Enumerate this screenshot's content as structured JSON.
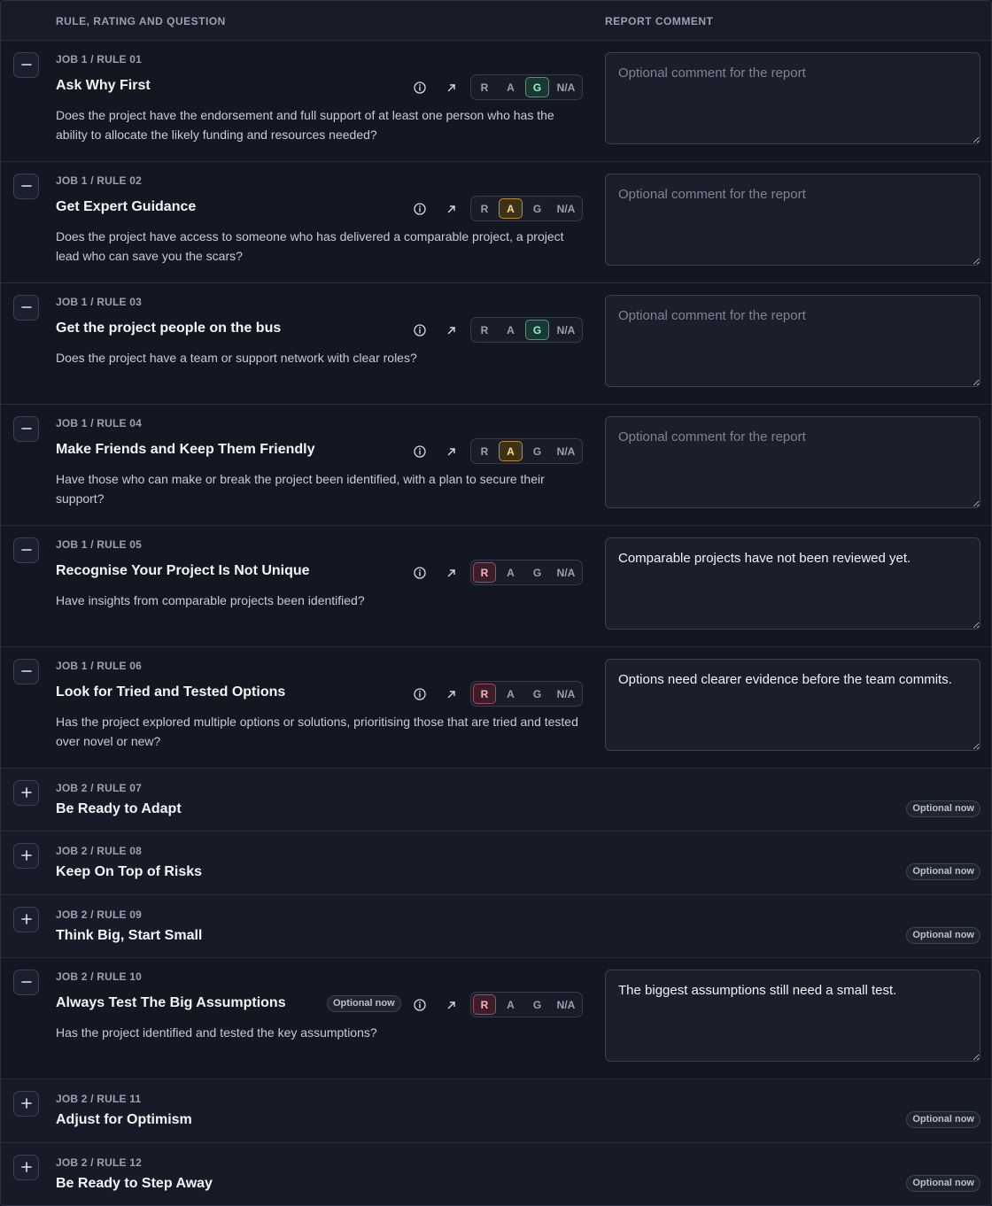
{
  "header": {
    "left": "RULE, RATING AND QUESTION",
    "right": "REPORT COMMENT"
  },
  "rating_options": [
    "R",
    "A",
    "G",
    "N/A"
  ],
  "comment_placeholder": "Optional comment for the report",
  "optional_badge": "Optional now",
  "rules": [
    {
      "meta": "JOB 1 / RULE 01",
      "title": "Ask Why First",
      "question": "Does the project have the endorsement and full support of at least one person who has the ability to allocate the likely funding and resources needed?",
      "rating": "G",
      "comment": ""
    },
    {
      "meta": "JOB 1 / RULE 02",
      "title": "Get Expert Guidance",
      "question": "Does the project have access to someone who has delivered a comparable project, a project lead who can save you the scars?",
      "rating": "A",
      "comment": ""
    },
    {
      "meta": "JOB 1 / RULE 03",
      "title": "Get the project people on the bus",
      "question": "Does the project have a team or support network with clear roles?",
      "rating": "G",
      "comment": ""
    },
    {
      "meta": "JOB 1 / RULE 04",
      "title": "Make Friends and Keep Them Friendly",
      "question": "Have those who can make or break the project been identified, with a plan to secure their support?",
      "rating": "A",
      "comment": ""
    },
    {
      "meta": "JOB 1 / RULE 05",
      "title": "Recognise Your Project Is Not Unique",
      "question": "Have insights from comparable projects been identified?",
      "rating": "R",
      "comment": "Comparable projects have not been reviewed yet."
    },
    {
      "meta": "JOB 1 / RULE 06",
      "title": "Look for Tried and Tested Options",
      "question": "Has the project explored multiple options or solutions, prioritising those that are tried and tested over novel or new?",
      "rating": "R",
      "comment": "Options need clearer evidence before the team commits."
    },
    {
      "meta": "JOB 2 / RULE 07",
      "title": "Be Ready to Adapt",
      "collapsed": true,
      "optional": true
    },
    {
      "meta": "JOB 2 / RULE 08",
      "title": "Keep On Top of Risks",
      "collapsed": true,
      "optional": true
    },
    {
      "meta": "JOB 2 / RULE 09",
      "title": "Think Big, Start Small",
      "collapsed": true,
      "optional": true
    },
    {
      "meta": "JOB 2 / RULE 10",
      "title": "Always Test The Big Assumptions",
      "question": "Has the project identified and tested the key assumptions?",
      "rating": "R",
      "comment": "The biggest assumptions still need a small test.",
      "optional": true
    },
    {
      "meta": "JOB 2 / RULE 11",
      "title": "Adjust for Optimism",
      "collapsed": true,
      "optional": true
    },
    {
      "meta": "JOB 2 / RULE 12",
      "title": "Be Ready to Step Away",
      "collapsed": true,
      "optional": true
    }
  ],
  "icons": {
    "expanded": "minus-icon",
    "collapsed": "plus-icon",
    "info": "info-icon",
    "open": "arrow-up-right-icon"
  },
  "colors": {
    "background": "#141824",
    "red": "#ffb2bf",
    "amber": "#ffd98a",
    "green": "#95f0cf"
  }
}
